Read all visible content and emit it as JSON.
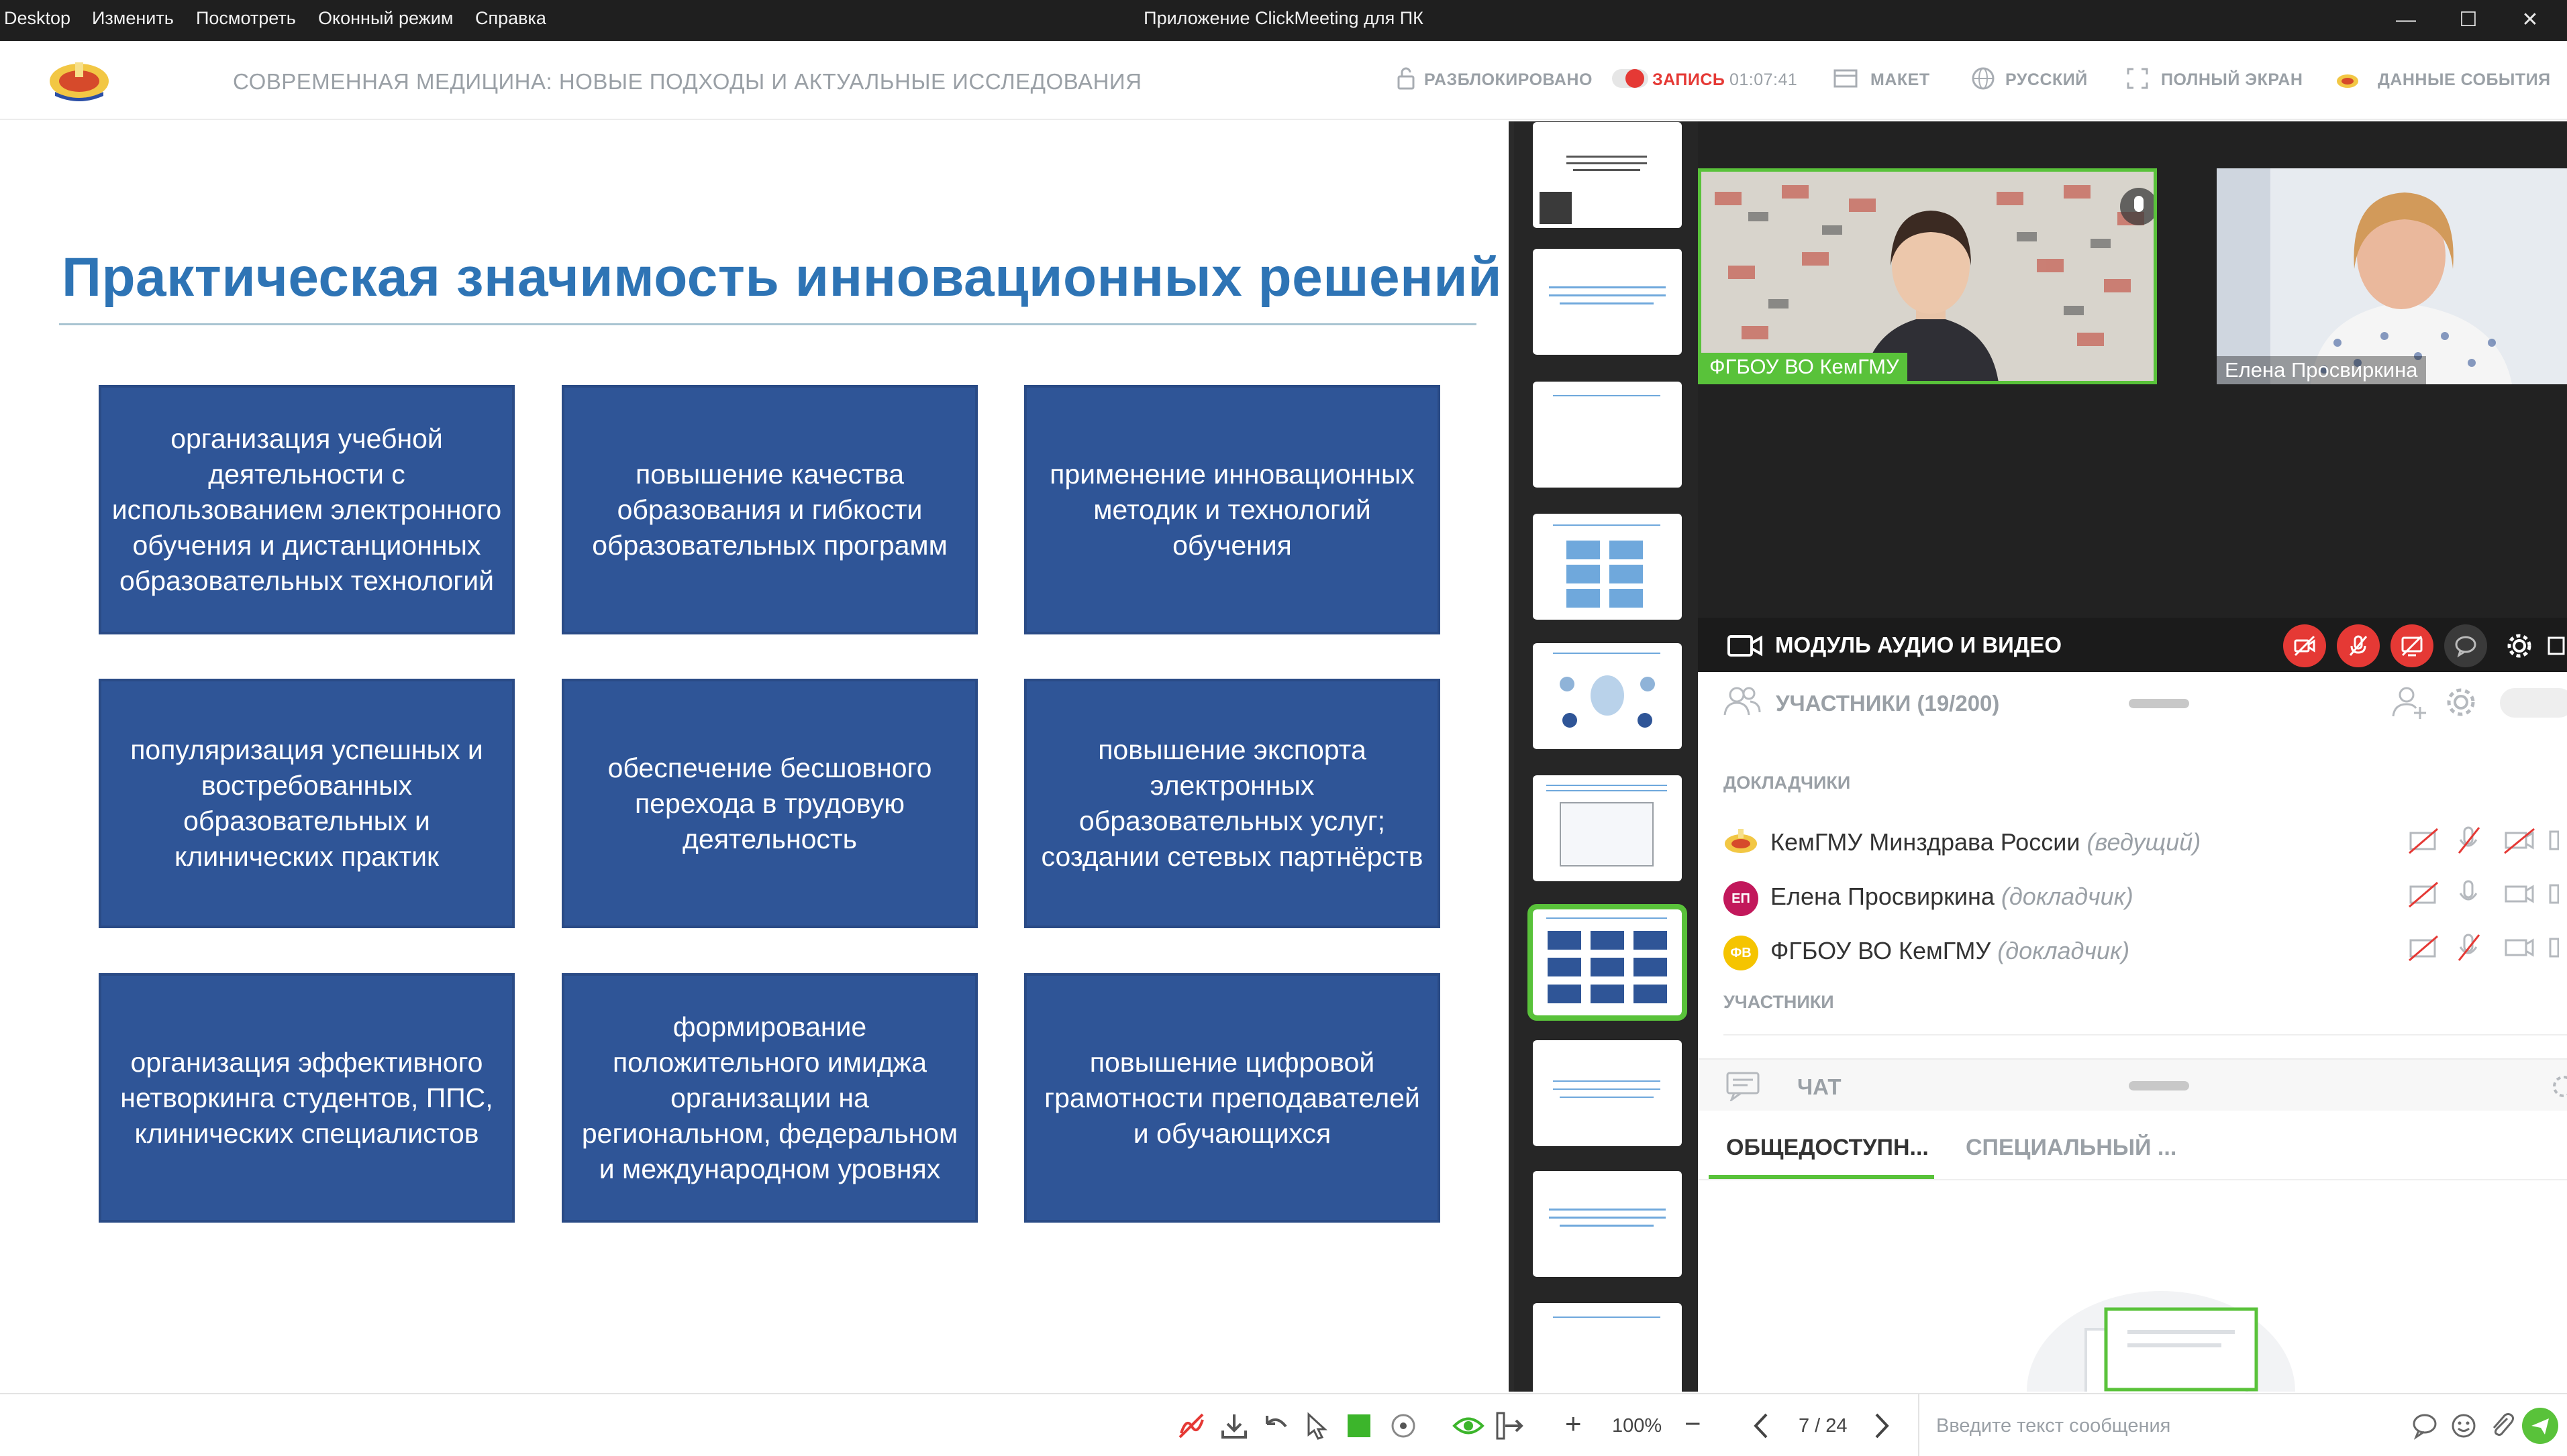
{
  "menu": {
    "items": [
      "Desktop",
      "Изменить",
      "Посмотреть",
      "Оконный режим",
      "Справка"
    ],
    "window_title": "Приложение ClickMeeting для ПК",
    "controls": [
      "—",
      "☐",
      "✕"
    ]
  },
  "header": {
    "event_title": "СОВРЕМЕННАЯ МЕДИЦИНА: НОВЫЕ ПОДХОДЫ И АКТУАЛЬНЫЕ ИССЛЕДОВАНИЯ",
    "unlocked_label": "РАЗБЛОКИРОВАНО",
    "record_label": "ЗАПИСЬ",
    "record_time": "01:07:41",
    "layout_label": "МАКЕТ",
    "language_label": "РУССКИЙ",
    "fullscreen_label": "ПОЛНЫЙ ЭКРАН",
    "event_data_label": "ДАННЫЕ СОБЫТИЯ",
    "record_color": "#e53935"
  },
  "slide": {
    "title": "Практическая значимость инновационных решений",
    "title_color": "#2e74b5",
    "block_color": "#2f5597",
    "blocks": [
      "организация учебной деятельности с использованием электронного обучения и дистанционных образовательных технологий",
      "повышение качества образования и гибкости образовательных программ",
      "применение инновационных методик и технологий обучения",
      "популяризация успешных и востребованных образовательных и клинических практик",
      "обеспечение бесшовного перехода в трудовую деятельность",
      "повышение экспорта электронных образовательных услуг; создании сетевых партнёрств",
      "организация эффективного нетворкинга студентов, ППС, клинических специалистов",
      "формирование положительного имиджа организации на региональном, федеральном и международном уровнях",
      "повышение цифровой грамотности преподавателей и обучающихся"
    ]
  },
  "thumbnails": {
    "active_index": 6,
    "active_color": "#59c23a"
  },
  "video": {
    "tile1_label": "ФГБОУ ВО КемГМУ",
    "tile2_label": "Елена Просвиркина",
    "module_title": "МОДУЛЬ АУДИО И ВИДЕО"
  },
  "participants": {
    "header": "УЧАСТНИКИ (19/200)",
    "speakers_label": "ДОКЛАДЧИКИ",
    "participants_label": "УЧАСТНИКИ",
    "list": [
      {
        "name": "КемГМУ Минздрава России",
        "role": "(ведущий)",
        "avatar": "",
        "avatar_color": "#f5a623"
      },
      {
        "name": "Елена Просвиркина",
        "role": "(докладчик)",
        "avatar": "ЕП",
        "avatar_color": "#c2185b"
      },
      {
        "name": "ФГБОУ ВО КемГМУ",
        "role": "(докладчик)",
        "avatar": "ФВ",
        "avatar_color": "#f5c400"
      }
    ]
  },
  "chat": {
    "header": "ЧАТ",
    "tab_public": "ОБЩЕДОСТУПН...",
    "tab_special": "СПЕЦИАЛЬНЫЙ ...",
    "message_placeholder": "Введите текст сообщения"
  },
  "toolbar": {
    "zoom": "100%",
    "page": "7 / 24",
    "plus": "+",
    "minus": "−"
  },
  "icons": [
    "draw-off-icon",
    "download-icon",
    "undo-icon",
    "pointer-icon",
    "color-square-icon",
    "laser-icon",
    "eye-icon",
    "exit-presentation-icon",
    "zoom-in-icon",
    "zoom-out-icon",
    "prev-page-icon",
    "next-page-icon",
    "emoji-icon",
    "attach-icon",
    "send-icon",
    "lock-icon",
    "layout-icon",
    "globe-icon",
    "fullscreen-icon",
    "camera-icon",
    "mic-off-icon",
    "gear-icon",
    "add-user-icon",
    "users-icon",
    "chat-icon"
  ]
}
